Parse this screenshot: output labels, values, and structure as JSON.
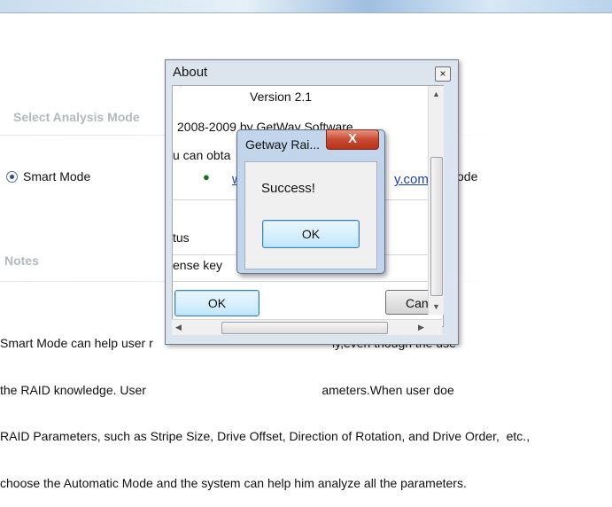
{
  "background": {
    "analysis_section_title": "Select Analysis Mode",
    "smart_mode_label": "Smart Mode",
    "other_mode_label_fragment": "ode",
    "notes_section_title": "Notes",
    "notes_lines": [
      "Smart Mode can help user r                                                    ly,even though the use",
      "the RAID knowledge. User                                                   ameters.When user doe",
      "RAID Parameters, such as Stripe Size, Drive Offset, Direction of Rotation, and Drive Order,  etc.,",
      "choose the Automatic Mode and the system can help him analyze all the parameters."
    ]
  },
  "about_dialog": {
    "title": "About",
    "close_glyph": "×",
    "version": "Version 2.1",
    "copyright": "2008-2009 by GetWay Software",
    "obtain_text": "u can obta",
    "link_left": "w",
    "link_right": "y.com",
    "status_label": "tus",
    "license_label": "ense key",
    "ok_label": "OK",
    "cancel_label": "Can"
  },
  "message_box": {
    "title": "Getway Rai...",
    "close_glyph": "X",
    "message": "Success!",
    "ok_label": "OK"
  }
}
